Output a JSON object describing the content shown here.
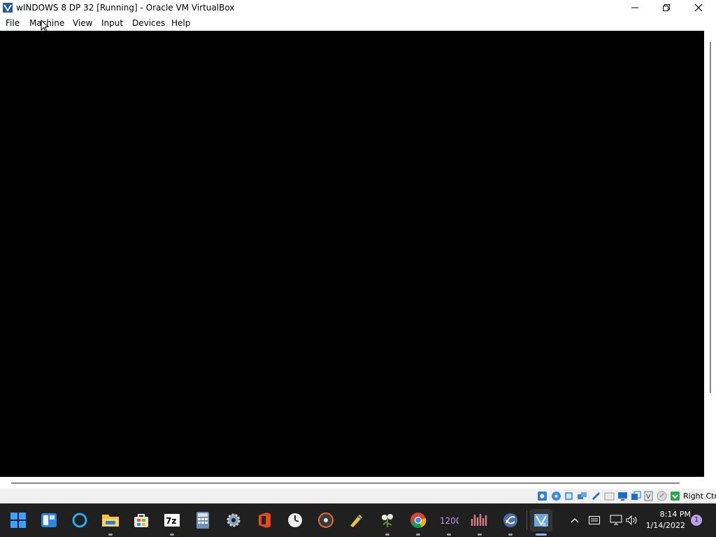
{
  "window": {
    "title": "wINDOWS 8 DP 32 [Running] - Oracle VM VirtualBox"
  },
  "menu": {
    "items": [
      "File",
      "Machine",
      "View",
      "Input",
      "Devices",
      "Help"
    ]
  },
  "statusbar": {
    "host_key": "Right Ctrl",
    "icons": [
      "hard-disk-icon",
      "optical-drive-icon",
      "audio-icon",
      "network-icon",
      "usb-icon",
      "shared-folders-icon",
      "display-icon",
      "video-capture-icon",
      "cpu-icon",
      "mouse-integration-icon",
      "host-key-icon"
    ]
  },
  "taskbar": {
    "apps": [
      "start-icon",
      "widgets-icon",
      "cortana-icon",
      "file-explorer-icon",
      "store-icon",
      "7zip-icon",
      "calculator-icon",
      "settings-icon",
      "office-icon",
      "clock-icon",
      "media-player-icon",
      "paint-icon",
      "plant-app-icon",
      "1200-app-icon",
      "audio-app-icon",
      "app-icon",
      "virtualbox-icon"
    ],
    "time": "8:14 PM",
    "date": "1/14/2022",
    "notification_count": "1"
  },
  "colors": {
    "taskbar_bg": "#202020",
    "vm_screen": "#000000",
    "status_bg": "#f0f0f0"
  }
}
